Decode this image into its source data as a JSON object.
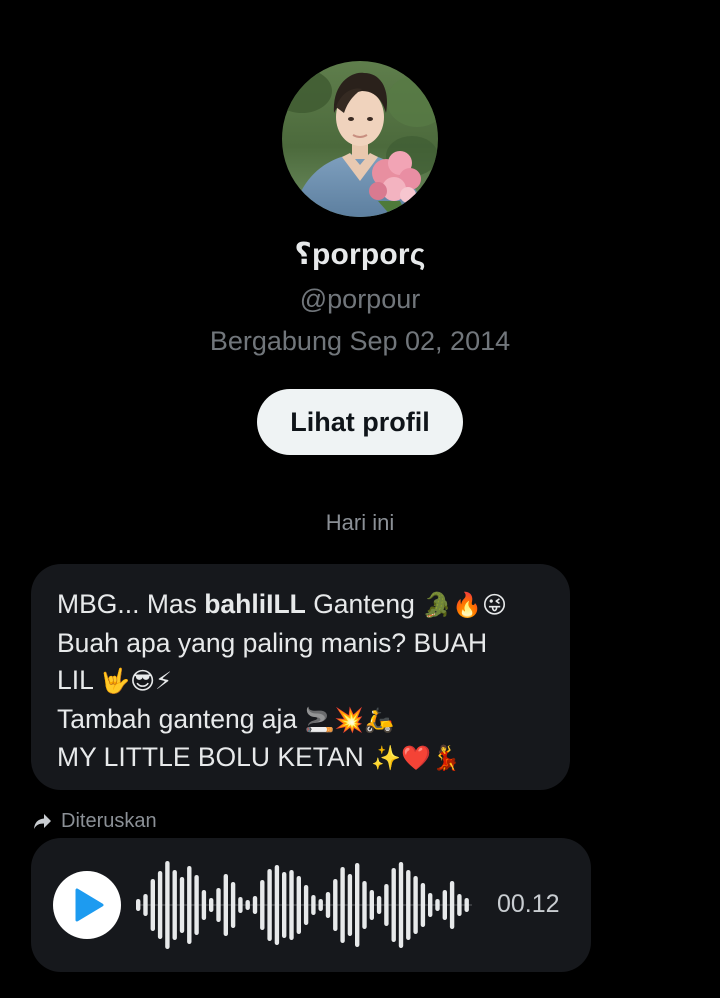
{
  "profile": {
    "display_name": "⸮porporς",
    "handle": "@porpour",
    "joined": "Bergabung Sep 02, 2014",
    "view_profile_label": "Lihat profil"
  },
  "conversation": {
    "date_separator": "Hari ini",
    "message": {
      "lines": [
        {
          "pre": "MBG... Mas ",
          "bold": "bahliILL",
          "post": " Ganteng ",
          "emoji": "🐊🔥😜"
        },
        {
          "text": "Buah apa yang paling manis? BUAH"
        },
        {
          "text": "LIL ",
          "emoji": "🤟😎⚡"
        },
        {
          "text": "Tambah ganteng aja ",
          "emoji": "🚬💥🛵"
        },
        {
          "text": "MY LITTLE BOLU KETAN ",
          "emoji": "✨❤️💃"
        }
      ]
    },
    "forwarded_label": "Diteruskan",
    "voice_message": {
      "duration": "00.12",
      "progress": 0,
      "play_icon": "play-icon"
    }
  },
  "colors": {
    "background": "#000000",
    "bubble": "#16181c",
    "primary_text": "#e7e9ea",
    "secondary_text": "#71767b",
    "accent_blue": "#1d9bf0",
    "button_bg": "#eff3f4"
  }
}
